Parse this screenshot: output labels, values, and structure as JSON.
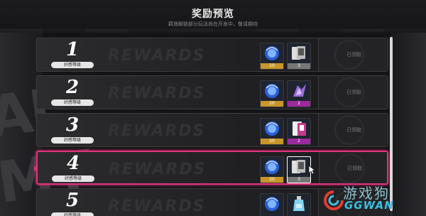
{
  "header": {
    "title": "奖励预览",
    "subtitle": "羁逸解锁部分玩法尚在开发中，敬请期待"
  },
  "watermark_text": "REWARDS",
  "level_label": "好感等级",
  "claim_label": "已领取",
  "rows": [
    {
      "level": "1",
      "items": [
        {
          "icon": "blue-orb-icon",
          "count": "10",
          "rarity": "gold"
        },
        {
          "icon": "cards-icon",
          "count": "3",
          "rarity": "silver"
        }
      ]
    },
    {
      "level": "2",
      "items": [
        {
          "icon": "blue-orb-icon",
          "count": "20",
          "rarity": "gold"
        },
        {
          "icon": "purple-crystal-icon",
          "count": "2",
          "rarity": "purple"
        }
      ]
    },
    {
      "level": "3",
      "items": [
        {
          "icon": "blue-orb-icon",
          "count": "20",
          "rarity": "gold"
        },
        {
          "icon": "pink-card-icon",
          "count": "2",
          "rarity": "purple"
        }
      ]
    },
    {
      "level": "4",
      "items": [
        {
          "icon": "blue-orb-icon",
          "count": "20",
          "rarity": "gold"
        },
        {
          "icon": "cards-icon",
          "count": "3",
          "rarity": "silver"
        }
      ],
      "selected": true
    },
    {
      "level": "5",
      "items": [
        {
          "icon": "blue-orb-icon",
          "count": "",
          "rarity": "gold"
        },
        {
          "icon": "potion-icon",
          "count": "",
          "rarity": "blue"
        }
      ]
    }
  ],
  "logo": {
    "cn": "游戏狗",
    "en": "GGWAN"
  },
  "colors": {
    "accent": "#e0337d",
    "gold": "#c8962a",
    "purple": "#9a2a9e"
  }
}
